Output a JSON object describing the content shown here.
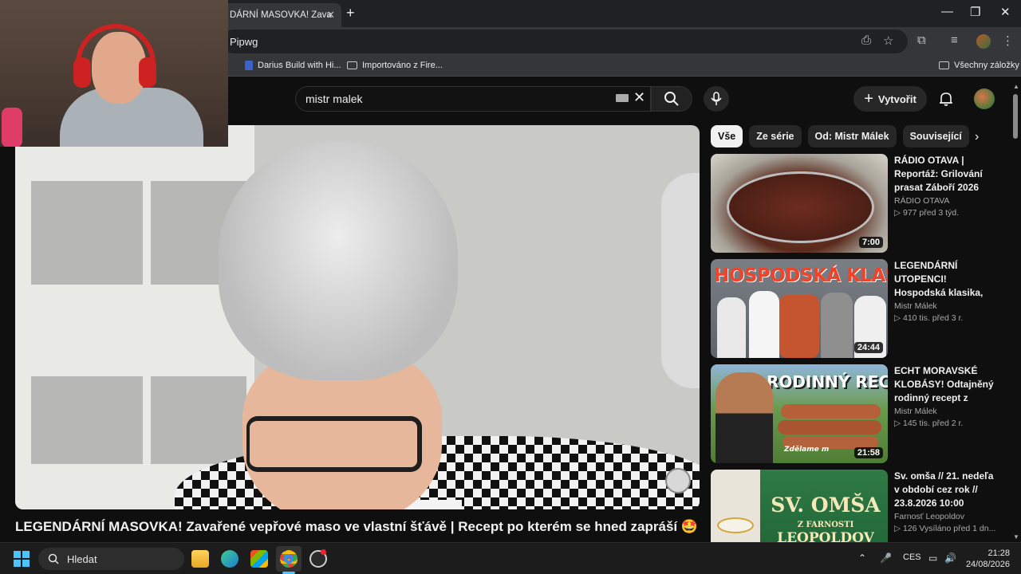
{
  "browser": {
    "tab_title": "DÁRNÍ MASOVKA! Zava",
    "url": "Pipwg",
    "bookmarks": [
      {
        "label": "Darius Build with Hi..."
      },
      {
        "label": "Importováno z Fire..."
      }
    ],
    "all_bookmarks": "Všechny záložky"
  },
  "youtube": {
    "search_value": "mistr malek",
    "create_label": "Vytvořit",
    "video_title": "LEGENDÁRNÍ MASOVKA! Zavařené vepřové maso ve vlastní šťávě | Recept po kterém se hned zapráší 🤩",
    "chips": [
      "Vše",
      "Ze série",
      "Od: Mistr Málek",
      "Související"
    ],
    "recommendations": [
      {
        "title": "RÁDIO OTAVA | Reportáž: Grilování prasat Záboří 2026",
        "channel": "RÁDIO OTAVA",
        "meta": "▷ 977   před 3 týd.",
        "duration": "7:00"
      },
      {
        "title": "LEGENDÁRNÍ UTOPENCI! Hospodská klasika, která nikdy ...",
        "channel": "Mistr Málek",
        "meta": "▷ 410 tis.   před 3 r.",
        "duration": "24:44",
        "thumb_text": "HOSPODSKÁ KLASIKA"
      },
      {
        "title": "ECHT MORAVSKÉ KLOBÁSY! Odtajněný rodinný recept z Mora...",
        "channel": "Mistr Málek",
        "meta": "▷ 145 tis.   před 2 r.",
        "duration": "21:58",
        "thumb_text": "RODINNÝ RECEPT",
        "thumb_sub": "Zdělame m"
      },
      {
        "title": "Sv. omša // 21. nedeľa v období cez rok // 23.8.2026 10:00",
        "channel": "Farnosť Leopoldov",
        "meta": "▷ 126   Vysíláno před 1 dn...",
        "thumb_text": "SV. OMŠA",
        "thumb_sub": "Z FARNOSTI",
        "thumb_sub2": "LEOPOLDOV"
      }
    ]
  },
  "taskbar": {
    "search_label": "Hledat",
    "lang": "CES",
    "time": "21:28",
    "date": "24/08/2026"
  }
}
